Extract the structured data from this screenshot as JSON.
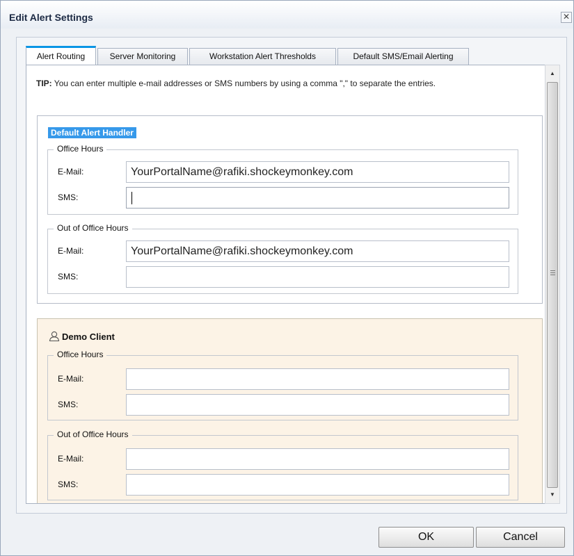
{
  "dialog": {
    "title": "Edit Alert Settings",
    "close_label": "✕"
  },
  "tabs": [
    {
      "label": "Alert Routing",
      "active": true
    },
    {
      "label": "Server Monitoring",
      "active": false
    },
    {
      "label": "Workstation Alert Thresholds",
      "active": false
    },
    {
      "label": "Default SMS/Email Alerting",
      "active": false
    }
  ],
  "tip": {
    "bold": "TIP:",
    "text": " You can enter multiple e-mail addresses or SMS numbers by using a comma \",\" to separate the entries."
  },
  "default_handler": {
    "title": "Default Alert Handler",
    "office_hours": {
      "legend": "Office Hours",
      "email_label": "E-Mail:",
      "email_value": "YourPortalName@rafiki.shockeymonkey.com",
      "sms_label": "SMS:",
      "sms_value": ""
    },
    "out_of_office": {
      "legend": "Out of Office Hours",
      "email_label": "E-Mail:",
      "email_value": "YourPortalName@rafiki.shockeymonkey.com",
      "sms_label": "SMS:",
      "sms_value": ""
    }
  },
  "demo_client": {
    "title": "Demo Client",
    "icon": "person-icon",
    "office_hours": {
      "legend": "Office Hours",
      "email_label": "E-Mail:",
      "email_value": "",
      "sms_label": "SMS:",
      "sms_value": ""
    },
    "out_of_office": {
      "legend": "Out of Office Hours",
      "email_label": "E-Mail:",
      "email_value": "",
      "sms_label": "SMS:",
      "sms_value": ""
    }
  },
  "buttons": {
    "ok": "OK",
    "cancel": "Cancel"
  },
  "colors": {
    "tab_accent": "#0b96e5",
    "handler_title_bg": "#3699ea",
    "client_box_bg": "#fcf3e6"
  }
}
